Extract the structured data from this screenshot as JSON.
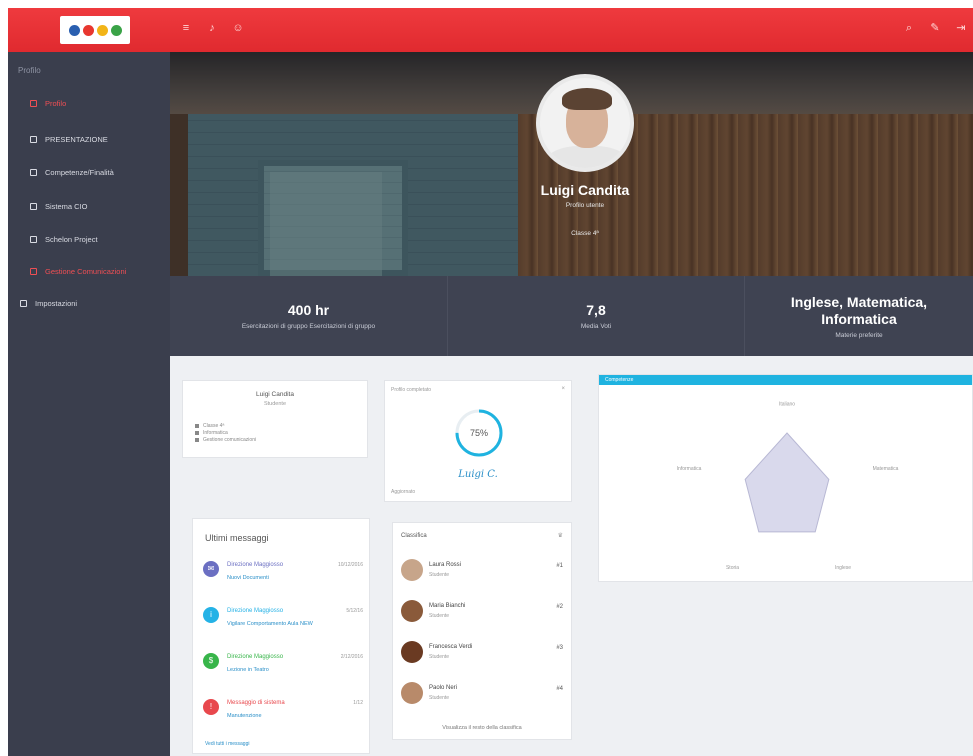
{
  "colors": {
    "topbar": "#e42f34",
    "sidebar": "#3a3e4d",
    "accent_blue": "#1fb3e0",
    "alert_red": "#ef4f54"
  },
  "topbar": {
    "logo_colors": [
      "#2a5fb0",
      "#e8372f",
      "#f2b417",
      "#3aa347"
    ],
    "left_icons": [
      "menu-icon",
      "bell-icon",
      "user-icon"
    ],
    "right_icons": [
      "search-icon",
      "pencil-icon",
      "logout-icon"
    ]
  },
  "sidebar": {
    "section_label": "Profilo",
    "items": [
      {
        "label": "Profilo",
        "active": true
      },
      {
        "label": "PRESENTAZIONE"
      },
      {
        "label": "Competenze/Finalità"
      },
      {
        "label": "Sistema CIO"
      },
      {
        "label": "Schelon Project"
      },
      {
        "label": "Gestione Comunicazioni",
        "active": true
      },
      {
        "label": "Impostazioni"
      }
    ]
  },
  "profile": {
    "name": "Luigi Candita",
    "subtitle": "Profilo utente",
    "class_label": "Classe 4ª"
  },
  "stats": [
    {
      "value": "400 hr",
      "label": "Esercitazioni di gruppo Esercitazioni di gruppo"
    },
    {
      "value": "7,8",
      "label": "Media Voti"
    },
    {
      "value": "Inglese, Matematica, Informatica",
      "label": "Materie preferite"
    }
  ],
  "mini_profile": {
    "name": "Luigi Candita",
    "role": "Studente",
    "items": [
      "Classe 4ª",
      "Informatica",
      "Gestione comunicazioni"
    ]
  },
  "donut": {
    "header": "Profilo completato",
    "close": "×",
    "percent_label": "75%",
    "percent": 0.75,
    "signature": "Luigi C.",
    "footer": "Aggiornato"
  },
  "radar": {
    "title": "Competenze",
    "axes": [
      "Italiano",
      "Matematica",
      "Inglese",
      "Storia",
      "Informatica"
    ],
    "values": [
      0.75,
      0.55,
      0.6,
      0.6,
      0.55
    ]
  },
  "messages": {
    "title": "Ultimi messaggi",
    "items": [
      {
        "from": "Direzione Maggiosso",
        "text": "Nuovi Documenti",
        "time": "10/12/2016",
        "color": "#6b6fc2",
        "icon": "document-icon"
      },
      {
        "from": "Direzione Maggiosso",
        "text": "Vigilare Comportamento Aula NEW",
        "time": "5/12/16",
        "color": "#25b2e6",
        "icon": "info-icon"
      },
      {
        "from": "Direzione Maggiosso",
        "text": "Lezione in Teatro",
        "time": "2/12/2016",
        "color": "#38b54a",
        "icon": "calendar-icon"
      },
      {
        "from": "Messaggio di sistema",
        "text": "Manutenzione",
        "time": "1/12",
        "color": "#e8484d",
        "icon": "alert-icon"
      }
    ],
    "more": "Vedi tutti i messaggi"
  },
  "ranking": {
    "title": "Classifica",
    "items": [
      {
        "name": "Laura Rossi",
        "role": "Studente",
        "pos": "#1",
        "color": "#c7a58a"
      },
      {
        "name": "Maria Bianchi",
        "role": "Studente",
        "pos": "#2",
        "color": "#8a5a3a"
      },
      {
        "name": "Francesca Verdi",
        "role": "Studente",
        "pos": "#3",
        "color": "#6a3a22"
      },
      {
        "name": "Paolo Neri",
        "role": "Studente",
        "pos": "#4",
        "color": "#b88a6a"
      }
    ],
    "view_all": "Visualizza il resto della classifica"
  }
}
